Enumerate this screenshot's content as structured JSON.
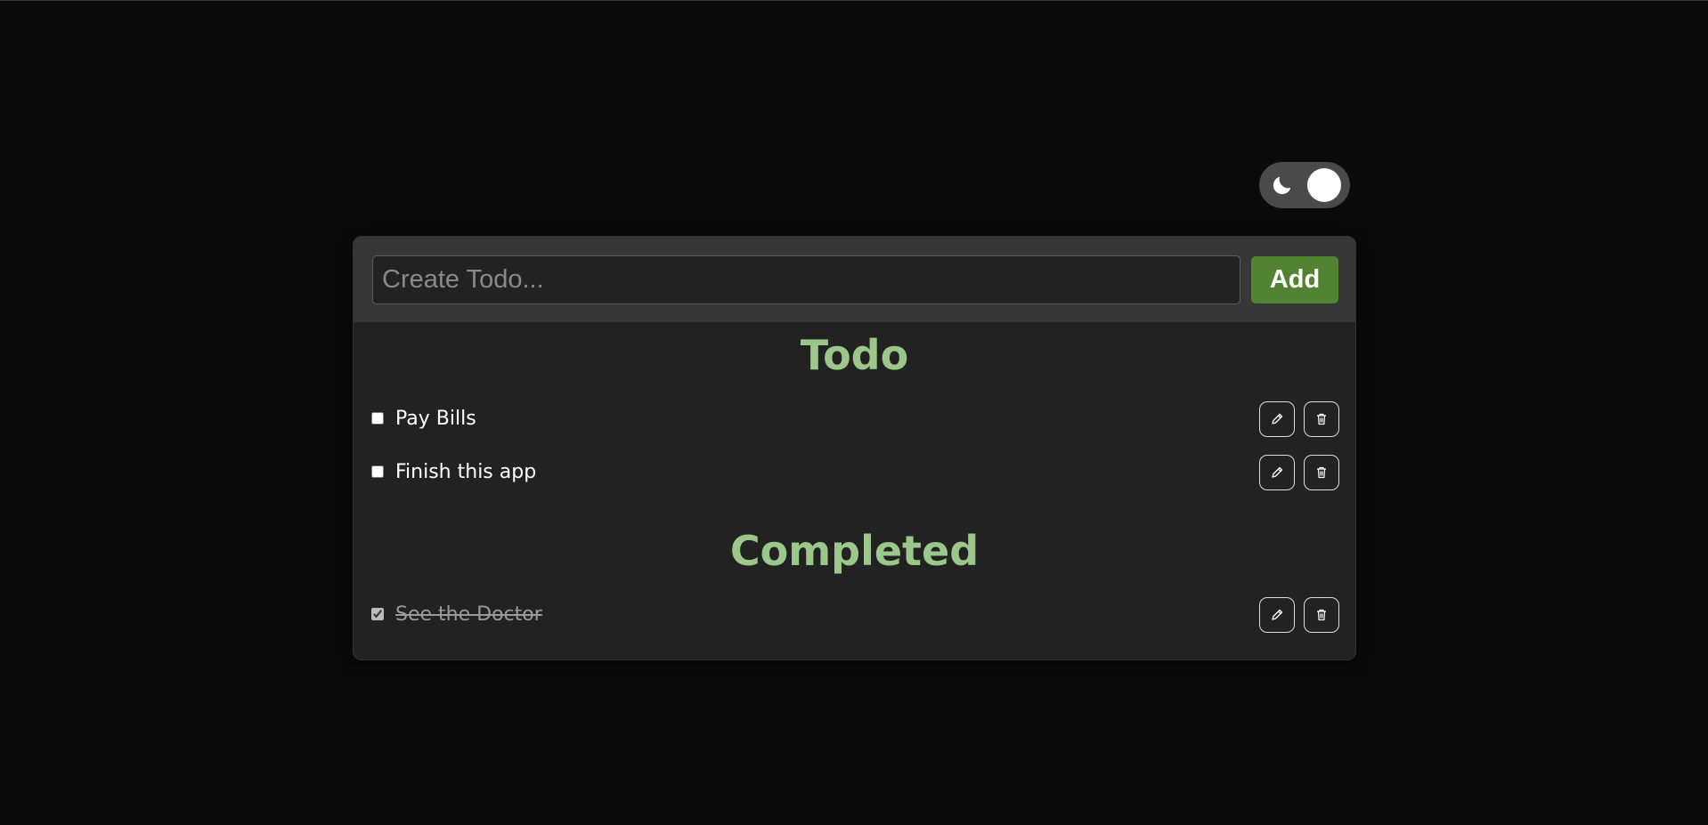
{
  "theme_toggle": {
    "mode": "dark",
    "icon": "moon-icon"
  },
  "composer": {
    "placeholder": "Create Todo...",
    "value": "",
    "add_label": "Add"
  },
  "todo": {
    "title": "Todo",
    "items": [
      {
        "label": "Pay Bills",
        "checked": false
      },
      {
        "label": "Finish this app",
        "checked": false
      }
    ]
  },
  "completed": {
    "title": "Completed",
    "items": [
      {
        "label": "See the Doctor",
        "checked": true
      }
    ]
  },
  "colors": {
    "background": "#0b0b0b",
    "card": "#222222",
    "header": "#373737",
    "accent_button": "#518332",
    "section_title": "#9cc78a"
  },
  "icons": {
    "edit": "pencil-icon",
    "delete": "trash-icon"
  }
}
